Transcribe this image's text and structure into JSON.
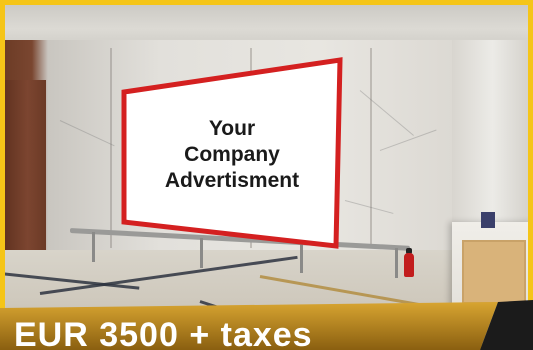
{
  "advertisement": {
    "line1": "Your",
    "line2": "Company",
    "line3": "Advertisment"
  },
  "price_banner": {
    "text": "EUR 3500 + taxes"
  },
  "colors": {
    "frame": "#f5c518",
    "billboard_border": "#d42020",
    "banner_gold": "#b8860b"
  }
}
